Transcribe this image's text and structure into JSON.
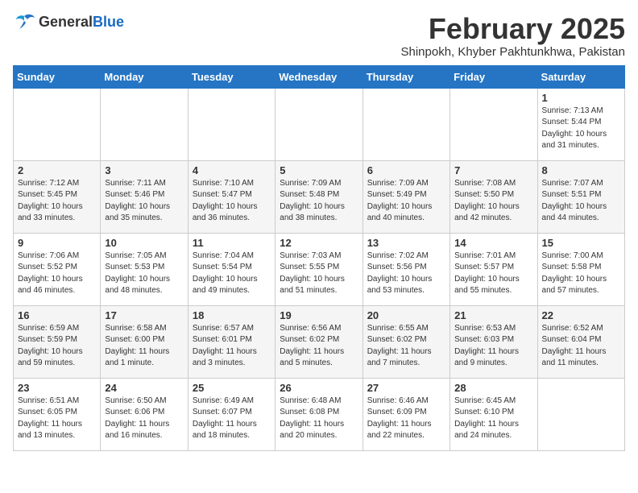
{
  "header": {
    "logo_general": "General",
    "logo_blue": "Blue",
    "month_year": "February 2025",
    "location": "Shinpokh, Khyber Pakhtunkhwa, Pakistan"
  },
  "weekdays": [
    "Sunday",
    "Monday",
    "Tuesday",
    "Wednesday",
    "Thursday",
    "Friday",
    "Saturday"
  ],
  "weeks": [
    [
      {
        "day": "",
        "info": ""
      },
      {
        "day": "",
        "info": ""
      },
      {
        "day": "",
        "info": ""
      },
      {
        "day": "",
        "info": ""
      },
      {
        "day": "",
        "info": ""
      },
      {
        "day": "",
        "info": ""
      },
      {
        "day": "1",
        "info": "Sunrise: 7:13 AM\nSunset: 5:44 PM\nDaylight: 10 hours and 31 minutes."
      }
    ],
    [
      {
        "day": "2",
        "info": "Sunrise: 7:12 AM\nSunset: 5:45 PM\nDaylight: 10 hours and 33 minutes."
      },
      {
        "day": "3",
        "info": "Sunrise: 7:11 AM\nSunset: 5:46 PM\nDaylight: 10 hours and 35 minutes."
      },
      {
        "day": "4",
        "info": "Sunrise: 7:10 AM\nSunset: 5:47 PM\nDaylight: 10 hours and 36 minutes."
      },
      {
        "day": "5",
        "info": "Sunrise: 7:09 AM\nSunset: 5:48 PM\nDaylight: 10 hours and 38 minutes."
      },
      {
        "day": "6",
        "info": "Sunrise: 7:09 AM\nSunset: 5:49 PM\nDaylight: 10 hours and 40 minutes."
      },
      {
        "day": "7",
        "info": "Sunrise: 7:08 AM\nSunset: 5:50 PM\nDaylight: 10 hours and 42 minutes."
      },
      {
        "day": "8",
        "info": "Sunrise: 7:07 AM\nSunset: 5:51 PM\nDaylight: 10 hours and 44 minutes."
      }
    ],
    [
      {
        "day": "9",
        "info": "Sunrise: 7:06 AM\nSunset: 5:52 PM\nDaylight: 10 hours and 46 minutes."
      },
      {
        "day": "10",
        "info": "Sunrise: 7:05 AM\nSunset: 5:53 PM\nDaylight: 10 hours and 48 minutes."
      },
      {
        "day": "11",
        "info": "Sunrise: 7:04 AM\nSunset: 5:54 PM\nDaylight: 10 hours and 49 minutes."
      },
      {
        "day": "12",
        "info": "Sunrise: 7:03 AM\nSunset: 5:55 PM\nDaylight: 10 hours and 51 minutes."
      },
      {
        "day": "13",
        "info": "Sunrise: 7:02 AM\nSunset: 5:56 PM\nDaylight: 10 hours and 53 minutes."
      },
      {
        "day": "14",
        "info": "Sunrise: 7:01 AM\nSunset: 5:57 PM\nDaylight: 10 hours and 55 minutes."
      },
      {
        "day": "15",
        "info": "Sunrise: 7:00 AM\nSunset: 5:58 PM\nDaylight: 10 hours and 57 minutes."
      }
    ],
    [
      {
        "day": "16",
        "info": "Sunrise: 6:59 AM\nSunset: 5:59 PM\nDaylight: 10 hours and 59 minutes."
      },
      {
        "day": "17",
        "info": "Sunrise: 6:58 AM\nSunset: 6:00 PM\nDaylight: 11 hours and 1 minute."
      },
      {
        "day": "18",
        "info": "Sunrise: 6:57 AM\nSunset: 6:01 PM\nDaylight: 11 hours and 3 minutes."
      },
      {
        "day": "19",
        "info": "Sunrise: 6:56 AM\nSunset: 6:02 PM\nDaylight: 11 hours and 5 minutes."
      },
      {
        "day": "20",
        "info": "Sunrise: 6:55 AM\nSunset: 6:02 PM\nDaylight: 11 hours and 7 minutes."
      },
      {
        "day": "21",
        "info": "Sunrise: 6:53 AM\nSunset: 6:03 PM\nDaylight: 11 hours and 9 minutes."
      },
      {
        "day": "22",
        "info": "Sunrise: 6:52 AM\nSunset: 6:04 PM\nDaylight: 11 hours and 11 minutes."
      }
    ],
    [
      {
        "day": "23",
        "info": "Sunrise: 6:51 AM\nSunset: 6:05 PM\nDaylight: 11 hours and 13 minutes."
      },
      {
        "day": "24",
        "info": "Sunrise: 6:50 AM\nSunset: 6:06 PM\nDaylight: 11 hours and 16 minutes."
      },
      {
        "day": "25",
        "info": "Sunrise: 6:49 AM\nSunset: 6:07 PM\nDaylight: 11 hours and 18 minutes."
      },
      {
        "day": "26",
        "info": "Sunrise: 6:48 AM\nSunset: 6:08 PM\nDaylight: 11 hours and 20 minutes."
      },
      {
        "day": "27",
        "info": "Sunrise: 6:46 AM\nSunset: 6:09 PM\nDaylight: 11 hours and 22 minutes."
      },
      {
        "day": "28",
        "info": "Sunrise: 6:45 AM\nSunset: 6:10 PM\nDaylight: 11 hours and 24 minutes."
      },
      {
        "day": "",
        "info": ""
      }
    ]
  ]
}
